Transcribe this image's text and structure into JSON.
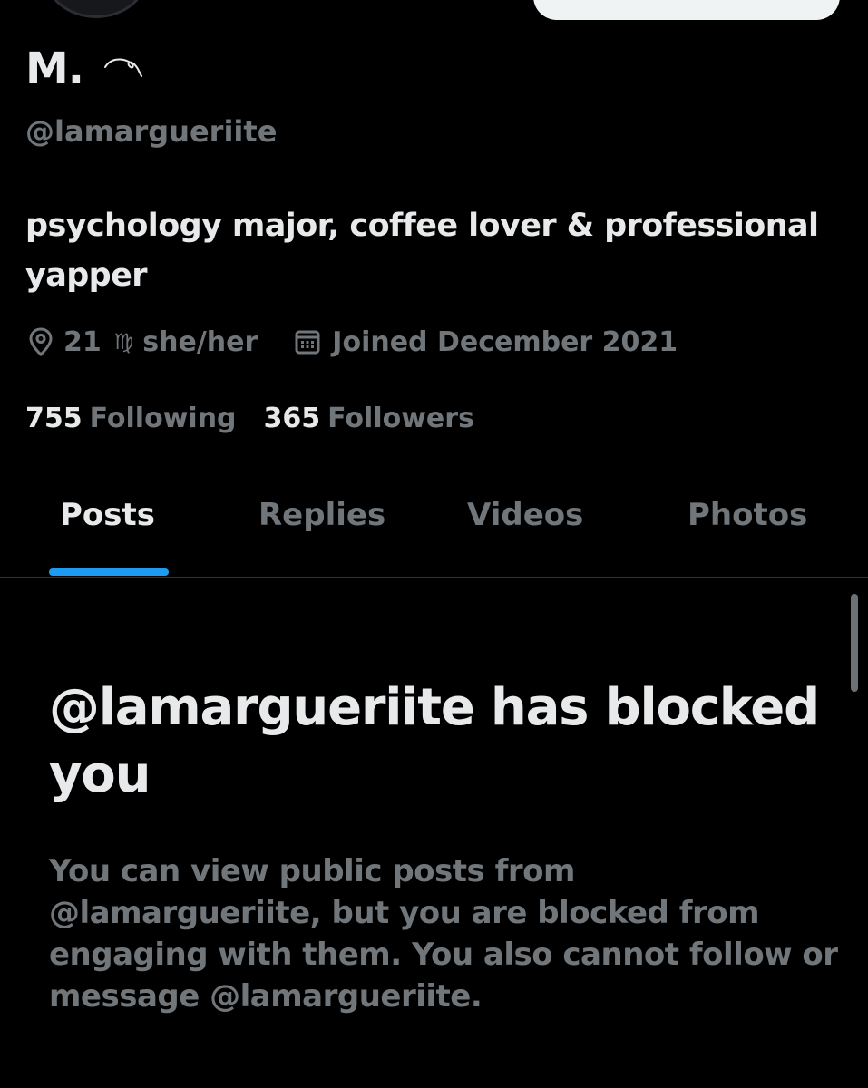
{
  "profile": {
    "display_name": "M.",
    "handle": "@lamargueriite",
    "bio": "psychology major, coffee lover & professional yapper",
    "location": "21",
    "zodiac_symbol": "♍",
    "pronouns": "she/her",
    "joined": "Joined December 2021",
    "following_count": "755",
    "following_label": "Following",
    "followers_count": "365",
    "followers_label": "Followers"
  },
  "tabs": [
    {
      "label": "Posts",
      "active": true
    },
    {
      "label": "Replies",
      "active": false
    },
    {
      "label": "Videos",
      "active": false
    },
    {
      "label": "Photos",
      "active": false
    }
  ],
  "blocked": {
    "title": "@lamargueriite has blocked you",
    "message": "You can view public posts from @lamargueriite, but you are blocked from engaging with them. You also cannot follow or message @lamargueriite."
  },
  "colors": {
    "background": "#000000",
    "primary_text": "#e7e9ea",
    "secondary_text": "#71767b",
    "accent": "#1d9bf0",
    "divider": "#2f3336"
  },
  "icons": {
    "location": "location-pin-icon",
    "zodiac": "virgo-icon",
    "joined": "calendar-icon"
  }
}
